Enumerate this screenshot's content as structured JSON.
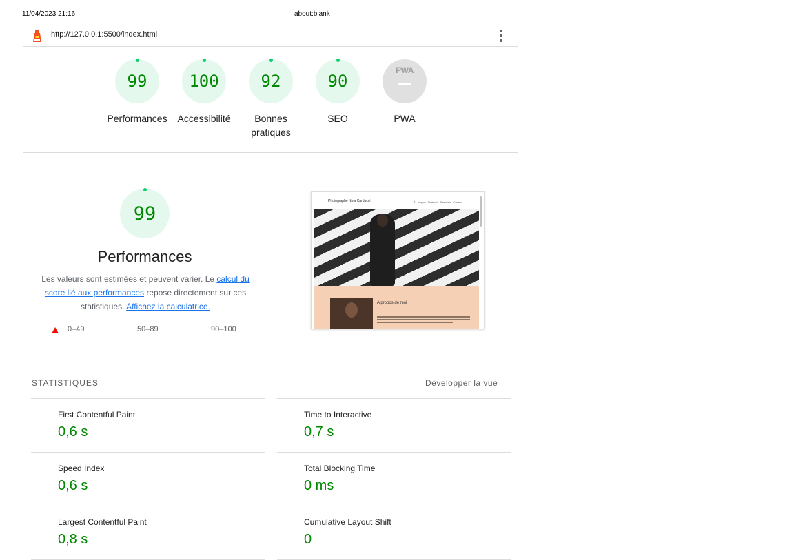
{
  "print_header": {
    "date": "11/04/2023 21:16",
    "page_title": "about:blank"
  },
  "topbar": {
    "url": "http://127.0.0.1:5500/index.html",
    "logo_icon": "lighthouse-icon",
    "menu_icon": "kebab-menu-icon"
  },
  "gauges": [
    {
      "score": "99",
      "label": "Performances"
    },
    {
      "score": "100",
      "label": "Accessibilité"
    },
    {
      "score": "92",
      "label": "Bonnes pratiques"
    },
    {
      "score": "90",
      "label": "SEO"
    },
    {
      "score": "",
      "label": "PWA",
      "badge": "PWA"
    }
  ],
  "performance": {
    "score": "99",
    "title": "Performances",
    "desc_prefix": "Les valeurs sont estimées et peuvent varier. Le ",
    "desc_link1": "calcul du score lié aux performances",
    "desc_middle": " repose directement sur ces statistiques. ",
    "desc_link2": "Affichez la calculatrice.",
    "legend": [
      "0–49",
      "50–89",
      "90–100"
    ]
  },
  "screenshot": {
    "site_name": "Photographe Nina Carducci",
    "nav": "À propos  Portfolio  Services  Contact",
    "about_title": "A propos de moi"
  },
  "stats": {
    "header": "STATISTIQUES",
    "expand_label": "Développer la vue",
    "metrics": [
      {
        "label": "First Contentful Paint",
        "value": "0,6 s"
      },
      {
        "label": "Time to Interactive",
        "value": "0,7 s"
      },
      {
        "label": "Speed Index",
        "value": "0,6 s"
      },
      {
        "label": "Total Blocking Time",
        "value": "0 ms"
      },
      {
        "label": "Largest Contentful Paint",
        "value": "0,8 s"
      },
      {
        "label": "Cumulative Layout Shift",
        "value": "0"
      }
    ]
  },
  "colors": {
    "pass": "#008800",
    "pass_fill": "#e5f8ee",
    "fail": "#eb0f00",
    "link": "#1a73e8"
  }
}
